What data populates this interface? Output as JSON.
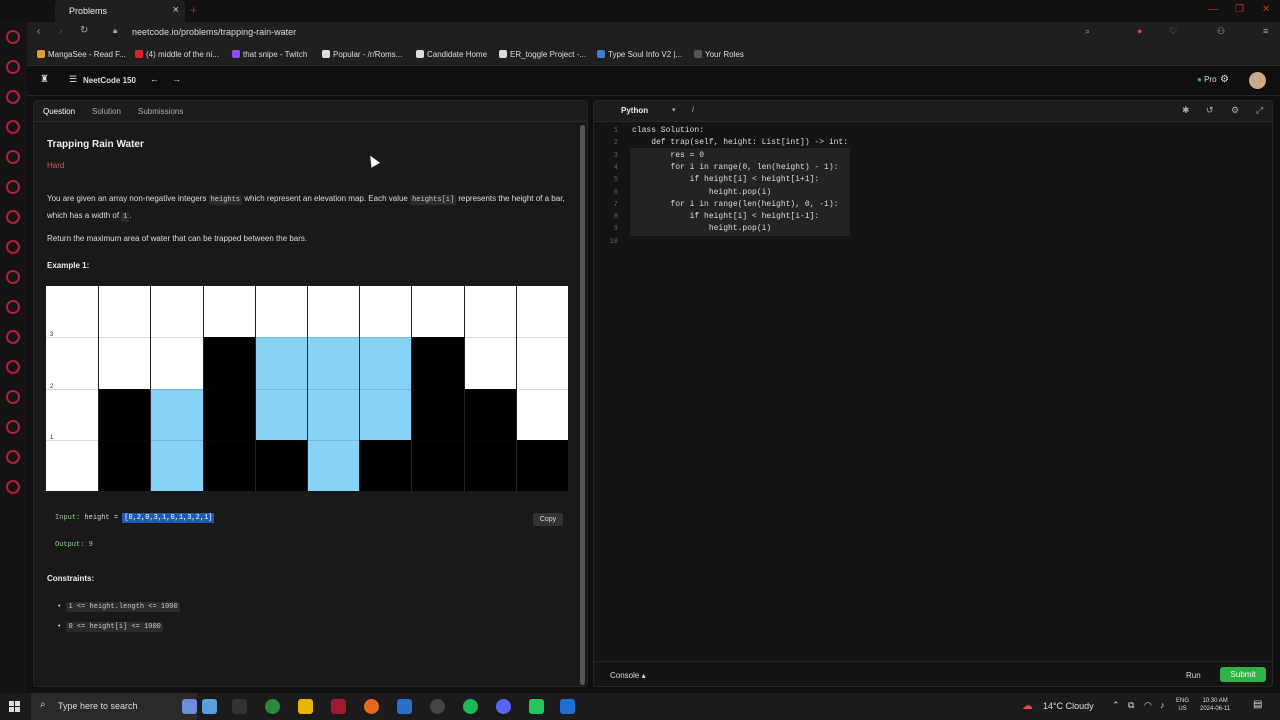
{
  "browser": {
    "tab_title": "Problems",
    "tab_close": "×",
    "new_tab": "+",
    "url": "neetcode.io/problems/trapping-rain-water",
    "bookmarks": [
      {
        "label": "MangaSee - Read F...",
        "color": "#e0a030"
      },
      {
        "label": "(4) middle of the ni...",
        "color": "#e02020"
      },
      {
        "label": "that snipe - Twitch",
        "color": "#9146ff"
      },
      {
        "label": "Popular - /r/Roms...",
        "color": "#dddddd"
      },
      {
        "label": "Candidate Home",
        "color": "#dddddd"
      },
      {
        "label": "ER_toggle Project -...",
        "color": "#dddddd"
      },
      {
        "label": "Type Soul Info V2 |...",
        "color": "#3a7bd5"
      },
      {
        "label": "Your Roles",
        "color": "#555555"
      }
    ]
  },
  "app": {
    "title": "NeetCode 150",
    "back": "←",
    "forward": "→",
    "pro_label": "Pro"
  },
  "left_panel": {
    "tabs": [
      "Question",
      "Solution",
      "Submissions"
    ],
    "problem_title": "Trapping Rain Water",
    "difficulty": "Hard",
    "desc_a": "You are given an array non-negative integers ",
    "desc_code1": "heights",
    "desc_b": " which represent an elevation map. Each value ",
    "desc_code2": "heights[i]",
    "desc_c": " represents the height of a bar, which has a width of ",
    "desc_code3": "1",
    "desc_d": ".",
    "desc2": "Return the maximum area of water that can be trapped between the bars.",
    "example_heading": "Example 1:",
    "input_label": "Input:",
    "input_var": "height",
    "input_eq": " = ",
    "input_value": "[0,2,0,3,1,0,1,3,2,1]",
    "copy_label": "Copy",
    "output_text": "Output: 9",
    "constraints_heading": "Constraints:",
    "constraints": [
      "1 <= height.length <= 1000",
      "0 <= height[i] <= 1000"
    ]
  },
  "figure": {
    "heights": [
      0,
      2,
      0,
      3,
      1,
      0,
      1,
      3,
      2,
      1
    ],
    "water": [
      0,
      0,
      2,
      0,
      2,
      3,
      2,
      0,
      0,
      0
    ],
    "y_ticks": [
      "3",
      "2",
      "1"
    ],
    "bar_color": "#000000",
    "water_color": "#87d3f5"
  },
  "editor": {
    "language": "Python",
    "info_icon": "i",
    "code_lines": [
      "class Solution:",
      "    def trap(self, height: List[int]) -> int:",
      "        res = 0",
      "        for i in range(0, len(height) - 1):",
      "            if height[i] < height[i+1]:",
      "                height.pop(i)",
      "        for i in range(len(height), 0, -1):",
      "            if height[i] < height[i-1]:",
      "                height.pop(i)",
      ""
    ],
    "console_label": "Console",
    "run_label": "Run",
    "submit_label": "Submit"
  },
  "taskbar": {
    "search_placeholder": "Type here to search",
    "weather": "14°C  Cloudy",
    "lang_line1": "ENG",
    "lang_line2": "US",
    "time": "10:30 AM",
    "date": "2024-06-11"
  }
}
